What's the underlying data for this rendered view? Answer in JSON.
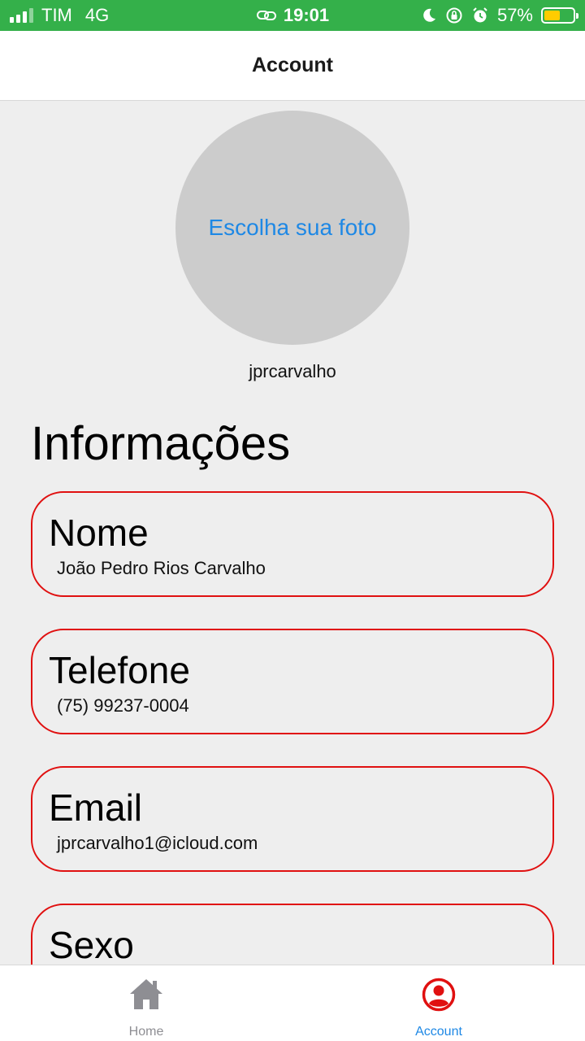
{
  "status_bar": {
    "carrier": "TIM",
    "network": "4G",
    "time": "19:01",
    "battery": "57%",
    "battery_level": 0.57,
    "icons": [
      "signal-icon",
      "link-icon",
      "moon-icon",
      "rotation-lock-icon",
      "alarm-icon",
      "battery-icon"
    ]
  },
  "nav": {
    "title": "Account"
  },
  "profile": {
    "photo_prompt": "Escolha sua foto",
    "username": "jprcarvalho"
  },
  "section": {
    "title": "Informações"
  },
  "fields": [
    {
      "label": "Nome",
      "value": "João Pedro Rios Carvalho"
    },
    {
      "label": "Telefone",
      "value": "(75) 99237-0004"
    },
    {
      "label": "Email",
      "value": "jprcarvalho1@icloud.com"
    },
    {
      "label": "Sexo",
      "value": ""
    }
  ],
  "tabs": [
    {
      "label": "Home",
      "icon": "home-icon",
      "active": false
    },
    {
      "label": "Account",
      "icon": "account-icon",
      "active": true
    }
  ],
  "colors": {
    "status_bar": "#34b04a",
    "accent_blue": "#1e88e5",
    "card_border": "#e01010",
    "active_icon": "#e01010",
    "inactive_icon": "#8e8e93"
  }
}
